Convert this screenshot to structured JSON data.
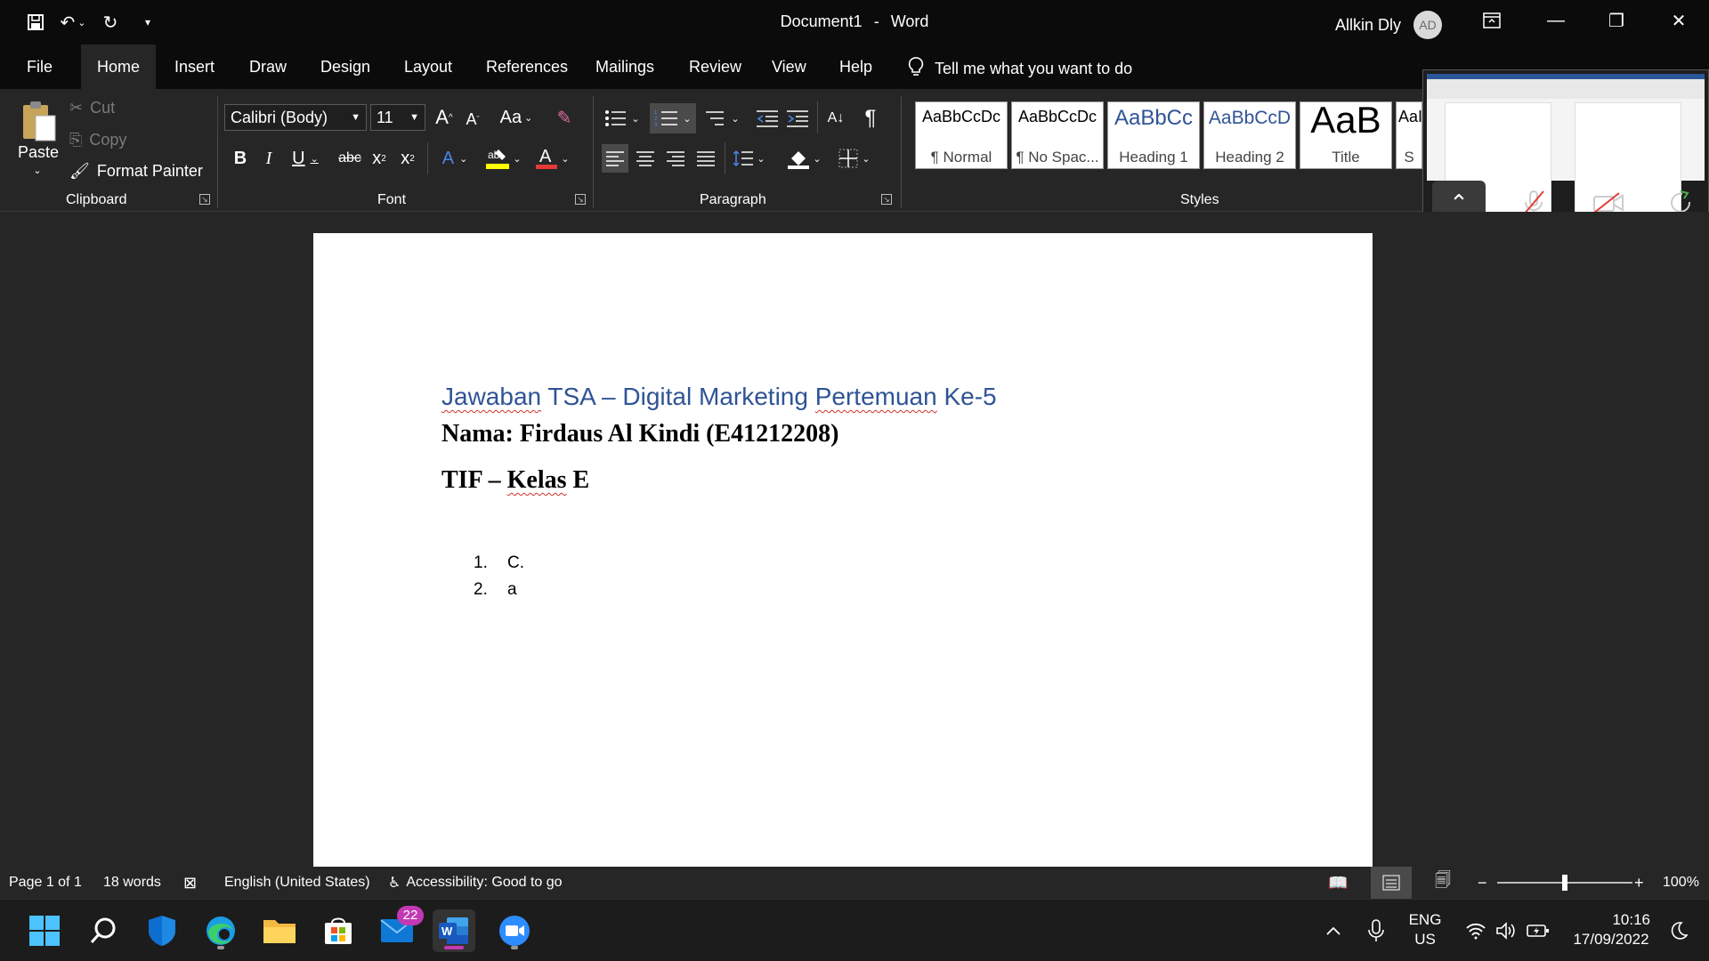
{
  "titlebar": {
    "document": "Document1",
    "separator": "-",
    "app": "Word",
    "user_name": "Allkin Dly",
    "user_initials": "AD"
  },
  "tabs": [
    "File",
    "Home",
    "Insert",
    "Draw",
    "Design",
    "Layout",
    "References",
    "Mailings",
    "Review",
    "View",
    "Help"
  ],
  "active_tab": "Home",
  "tell_me": "Tell me what you want to do",
  "clipboard": {
    "paste": "Paste",
    "cut": "Cut",
    "copy": "Copy",
    "format_painter": "Format Painter",
    "label": "Clipboard"
  },
  "font": {
    "family": "Calibri (Body)",
    "size": "11",
    "label": "Font",
    "case_btn": "Aa"
  },
  "paragraph": {
    "label": "Paragraph"
  },
  "styles": {
    "label": "Styles",
    "tiles": [
      {
        "preview": "AaBbCcDc",
        "name": "¶ Normal"
      },
      {
        "preview": "AaBbCcDc",
        "name": "¶ No Spac..."
      },
      {
        "preview": "AaBbCc",
        "name": "Heading 1"
      },
      {
        "preview": "AaBbCcD",
        "name": "Heading 2"
      },
      {
        "preview": "AaB",
        "name": "Title"
      },
      {
        "preview": "AaI",
        "name": "S"
      }
    ]
  },
  "document": {
    "heading_parts": [
      "Jawaban",
      " TSA – Digital Marketing ",
      "Pertemuan",
      " Ke-5"
    ],
    "name_line": "Nama: Firdaus Al Kindi (E41212208)",
    "class_parts": [
      "TIF – ",
      "Kelas",
      " E"
    ],
    "list": [
      {
        "num": "1.",
        "text": "C."
      },
      {
        "num": "2.",
        "text": "a"
      }
    ]
  },
  "status": {
    "page": "Page 1 of 1",
    "words": "18 words",
    "language": "English (United States)",
    "accessibility": "Accessibility: Good to go",
    "zoom": "100%",
    "zoom_level": 0.5
  },
  "taskbar": {
    "mail_badge": "22",
    "lang_top": "ENG",
    "lang_bottom": "US",
    "time": "10:16",
    "date": "17/09/2022"
  },
  "colors": {
    "accent_word": "#2b579a",
    "heading_blue": "#2f5496",
    "badge_purple": "#c239b3"
  }
}
